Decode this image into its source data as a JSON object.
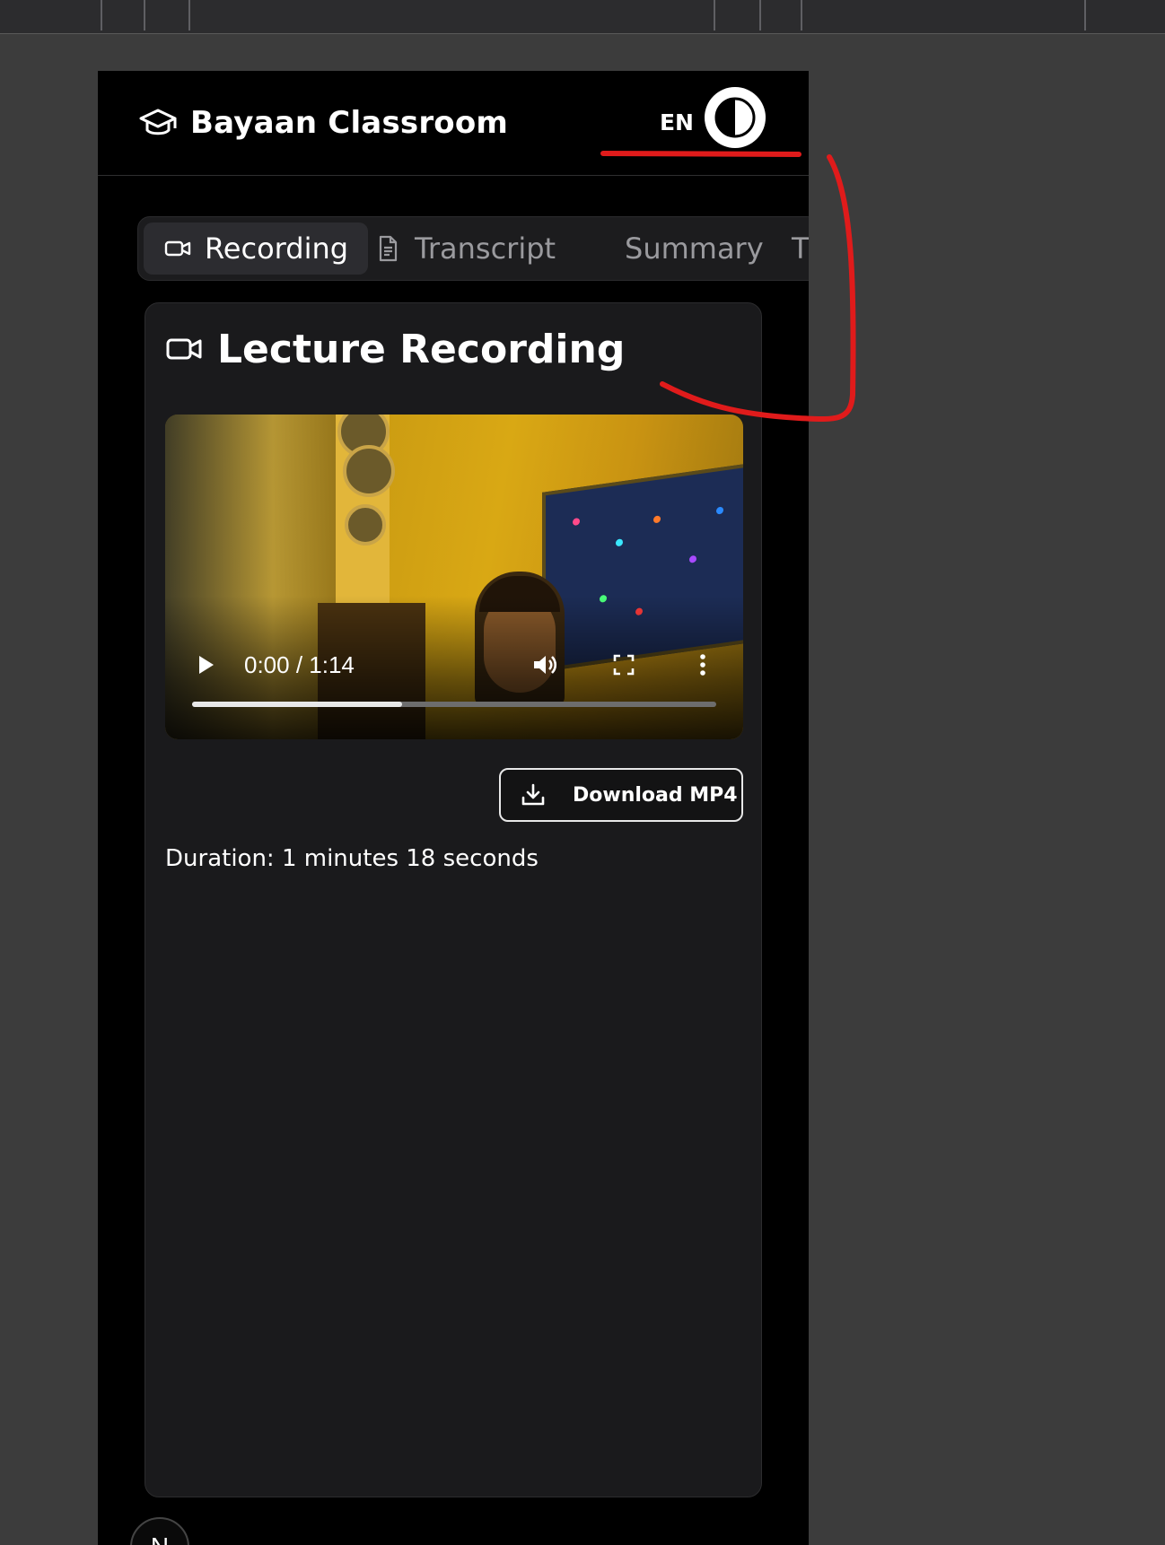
{
  "app": {
    "title": "Bayaan Classroom",
    "language": "EN",
    "brand_icon": "graduation-cap-icon",
    "theme_icon": "contrast-icon"
  },
  "tabs": [
    {
      "label": "Recording",
      "icon": "video-camera-icon",
      "active": true
    },
    {
      "label": "Transcript",
      "icon": "document-icon",
      "active": false
    },
    {
      "label": "Summary",
      "icon": "",
      "active": false
    },
    {
      "label": "T",
      "icon": "",
      "active": false
    }
  ],
  "card": {
    "title": "Lecture Recording",
    "icon": "video-camera-icon"
  },
  "video": {
    "current_time": "0:00 / 1:14",
    "buffered_fraction": 0.4
  },
  "download": {
    "label": "Download MP4",
    "icon": "download-icon"
  },
  "duration_text": "Duration: 1 minutes 18 seconds",
  "bottom_avatar_letter": "N",
  "colors": {
    "accent_annotation": "#e01b1b",
    "background": "#000000",
    "card": "#1a1a1c"
  }
}
